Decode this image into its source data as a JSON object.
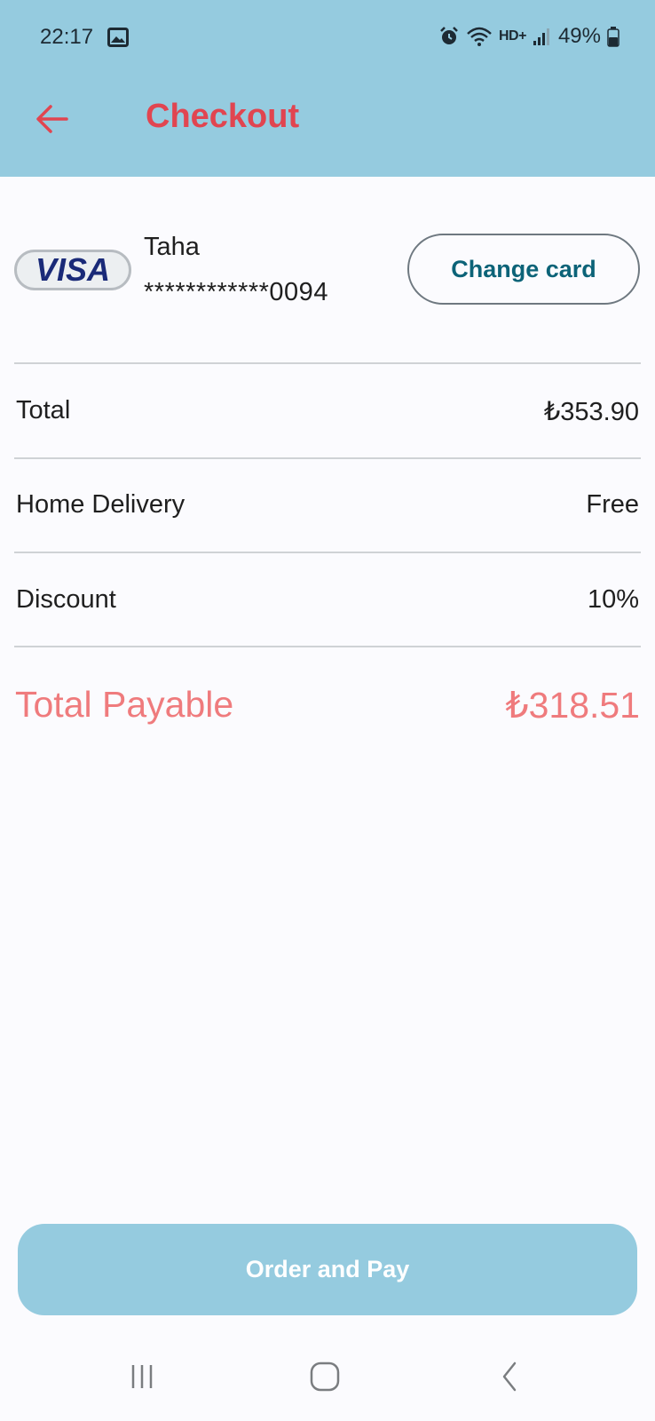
{
  "status_bar": {
    "time": "22:17",
    "network_label": "HD+",
    "battery": "49%",
    "icons": [
      "gallery-icon",
      "alarm-icon",
      "wifi-icon",
      "signal-icon",
      "battery-icon"
    ]
  },
  "app_bar": {
    "title": "Checkout",
    "back_icon": "arrow-left-icon"
  },
  "card": {
    "brand": "VISA",
    "holder": "Taha",
    "number": "************0094",
    "change_label": "Change card"
  },
  "summary": {
    "rows": [
      {
        "label": "Total",
        "value": "₺353.90"
      },
      {
        "label": "Home Delivery",
        "value": "Free"
      },
      {
        "label": "Discount",
        "value": "10%"
      }
    ],
    "payable_label": "Total Payable",
    "payable_value": "₺318.51"
  },
  "order_button": {
    "label": "Order and Pay"
  },
  "navigation": {
    "items": [
      "recent-apps-icon",
      "home-icon",
      "back-icon"
    ]
  },
  "colors": {
    "app_bar": "#95cbdf",
    "title": "#e14550",
    "accent_text": "#0c6378",
    "payable": "#ef7b7d",
    "button": "#95cbdf",
    "background": "#fbfbfe"
  }
}
